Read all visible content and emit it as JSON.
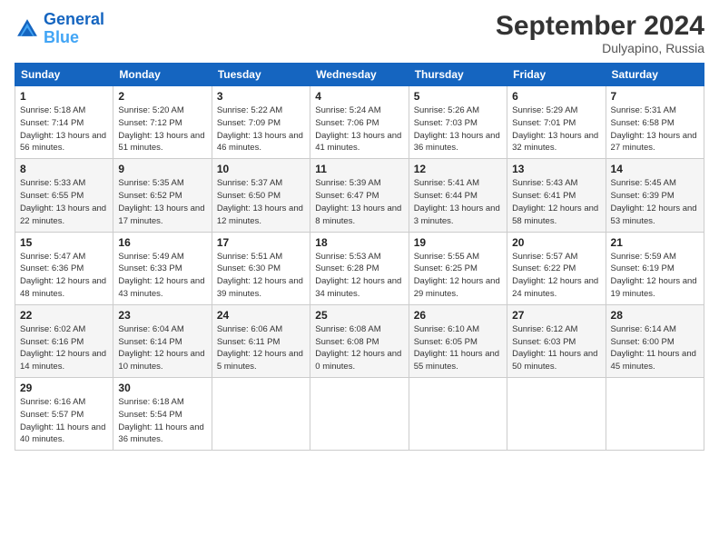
{
  "header": {
    "logo_line1": "General",
    "logo_line2": "Blue",
    "month_title": "September 2024",
    "location": "Dulyapino, Russia"
  },
  "weekdays": [
    "Sunday",
    "Monday",
    "Tuesday",
    "Wednesday",
    "Thursday",
    "Friday",
    "Saturday"
  ],
  "weeks": [
    [
      {
        "day": "1",
        "sunrise": "Sunrise: 5:18 AM",
        "sunset": "Sunset: 7:14 PM",
        "daylight": "Daylight: 13 hours and 56 minutes."
      },
      {
        "day": "2",
        "sunrise": "Sunrise: 5:20 AM",
        "sunset": "Sunset: 7:12 PM",
        "daylight": "Daylight: 13 hours and 51 minutes."
      },
      {
        "day": "3",
        "sunrise": "Sunrise: 5:22 AM",
        "sunset": "Sunset: 7:09 PM",
        "daylight": "Daylight: 13 hours and 46 minutes."
      },
      {
        "day": "4",
        "sunrise": "Sunrise: 5:24 AM",
        "sunset": "Sunset: 7:06 PM",
        "daylight": "Daylight: 13 hours and 41 minutes."
      },
      {
        "day": "5",
        "sunrise": "Sunrise: 5:26 AM",
        "sunset": "Sunset: 7:03 PM",
        "daylight": "Daylight: 13 hours and 36 minutes."
      },
      {
        "day": "6",
        "sunrise": "Sunrise: 5:29 AM",
        "sunset": "Sunset: 7:01 PM",
        "daylight": "Daylight: 13 hours and 32 minutes."
      },
      {
        "day": "7",
        "sunrise": "Sunrise: 5:31 AM",
        "sunset": "Sunset: 6:58 PM",
        "daylight": "Daylight: 13 hours and 27 minutes."
      }
    ],
    [
      {
        "day": "8",
        "sunrise": "Sunrise: 5:33 AM",
        "sunset": "Sunset: 6:55 PM",
        "daylight": "Daylight: 13 hours and 22 minutes."
      },
      {
        "day": "9",
        "sunrise": "Sunrise: 5:35 AM",
        "sunset": "Sunset: 6:52 PM",
        "daylight": "Daylight: 13 hours and 17 minutes."
      },
      {
        "day": "10",
        "sunrise": "Sunrise: 5:37 AM",
        "sunset": "Sunset: 6:50 PM",
        "daylight": "Daylight: 13 hours and 12 minutes."
      },
      {
        "day": "11",
        "sunrise": "Sunrise: 5:39 AM",
        "sunset": "Sunset: 6:47 PM",
        "daylight": "Daylight: 13 hours and 8 minutes."
      },
      {
        "day": "12",
        "sunrise": "Sunrise: 5:41 AM",
        "sunset": "Sunset: 6:44 PM",
        "daylight": "Daylight: 13 hours and 3 minutes."
      },
      {
        "day": "13",
        "sunrise": "Sunrise: 5:43 AM",
        "sunset": "Sunset: 6:41 PM",
        "daylight": "Daylight: 12 hours and 58 minutes."
      },
      {
        "day": "14",
        "sunrise": "Sunrise: 5:45 AM",
        "sunset": "Sunset: 6:39 PM",
        "daylight": "Daylight: 12 hours and 53 minutes."
      }
    ],
    [
      {
        "day": "15",
        "sunrise": "Sunrise: 5:47 AM",
        "sunset": "Sunset: 6:36 PM",
        "daylight": "Daylight: 12 hours and 48 minutes."
      },
      {
        "day": "16",
        "sunrise": "Sunrise: 5:49 AM",
        "sunset": "Sunset: 6:33 PM",
        "daylight": "Daylight: 12 hours and 43 minutes."
      },
      {
        "day": "17",
        "sunrise": "Sunrise: 5:51 AM",
        "sunset": "Sunset: 6:30 PM",
        "daylight": "Daylight: 12 hours and 39 minutes."
      },
      {
        "day": "18",
        "sunrise": "Sunrise: 5:53 AM",
        "sunset": "Sunset: 6:28 PM",
        "daylight": "Daylight: 12 hours and 34 minutes."
      },
      {
        "day": "19",
        "sunrise": "Sunrise: 5:55 AM",
        "sunset": "Sunset: 6:25 PM",
        "daylight": "Daylight: 12 hours and 29 minutes."
      },
      {
        "day": "20",
        "sunrise": "Sunrise: 5:57 AM",
        "sunset": "Sunset: 6:22 PM",
        "daylight": "Daylight: 12 hours and 24 minutes."
      },
      {
        "day": "21",
        "sunrise": "Sunrise: 5:59 AM",
        "sunset": "Sunset: 6:19 PM",
        "daylight": "Daylight: 12 hours and 19 minutes."
      }
    ],
    [
      {
        "day": "22",
        "sunrise": "Sunrise: 6:02 AM",
        "sunset": "Sunset: 6:16 PM",
        "daylight": "Daylight: 12 hours and 14 minutes."
      },
      {
        "day": "23",
        "sunrise": "Sunrise: 6:04 AM",
        "sunset": "Sunset: 6:14 PM",
        "daylight": "Daylight: 12 hours and 10 minutes."
      },
      {
        "day": "24",
        "sunrise": "Sunrise: 6:06 AM",
        "sunset": "Sunset: 6:11 PM",
        "daylight": "Daylight: 12 hours and 5 minutes."
      },
      {
        "day": "25",
        "sunrise": "Sunrise: 6:08 AM",
        "sunset": "Sunset: 6:08 PM",
        "daylight": "Daylight: 12 hours and 0 minutes."
      },
      {
        "day": "26",
        "sunrise": "Sunrise: 6:10 AM",
        "sunset": "Sunset: 6:05 PM",
        "daylight": "Daylight: 11 hours and 55 minutes."
      },
      {
        "day": "27",
        "sunrise": "Sunrise: 6:12 AM",
        "sunset": "Sunset: 6:03 PM",
        "daylight": "Daylight: 11 hours and 50 minutes."
      },
      {
        "day": "28",
        "sunrise": "Sunrise: 6:14 AM",
        "sunset": "Sunset: 6:00 PM",
        "daylight": "Daylight: 11 hours and 45 minutes."
      }
    ],
    [
      {
        "day": "29",
        "sunrise": "Sunrise: 6:16 AM",
        "sunset": "Sunset: 5:57 PM",
        "daylight": "Daylight: 11 hours and 40 minutes."
      },
      {
        "day": "30",
        "sunrise": "Sunrise: 6:18 AM",
        "sunset": "Sunset: 5:54 PM",
        "daylight": "Daylight: 11 hours and 36 minutes."
      },
      null,
      null,
      null,
      null,
      null
    ]
  ]
}
